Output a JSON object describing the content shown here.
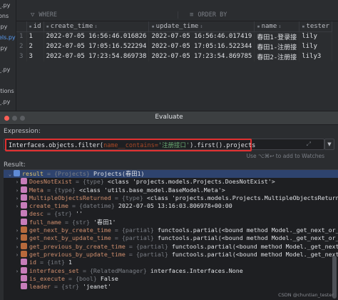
{
  "project_strip": {
    "items": [
      {
        "label": "_.py",
        "color": "normal"
      },
      {
        "label": "ons",
        "color": "normal"
      },
      {
        "label": ".py",
        "color": "normal"
      },
      {
        "label": "els.py",
        "color": "blue"
      },
      {
        "label": ".py",
        "color": "normal"
      },
      {
        "label": "",
        "color": "normal"
      },
      {
        "label": "_.py",
        "color": "normal"
      },
      {
        "label": "",
        "color": "normal"
      },
      {
        "label": "itions",
        "color": "normal"
      },
      {
        "label": "_.py",
        "color": "normal"
      }
    ]
  },
  "grid": {
    "filter_where_label": "WHERE",
    "filter_order_label": "ORDER BY",
    "columns": [
      {
        "label": "id",
        "sort": "↕"
      },
      {
        "label": "create_time",
        "sort": "↕"
      },
      {
        "label": "update_time",
        "sort": "↕"
      },
      {
        "label": "name",
        "sort": "↕"
      },
      {
        "label": "tester",
        "sort": ""
      }
    ],
    "rows": [
      {
        "num": "1",
        "id": "1",
        "create_time": "2022-07-05 16:56:46.016826",
        "update_time": "2022-07-05 16:56:46.017419",
        "name": "春田1-登录接",
        "tester": "lily"
      },
      {
        "num": "2",
        "id": "2",
        "create_time": "2022-07-05 17:05:16.522294",
        "update_time": "2022-07-05 17:05:16.522344",
        "name": "春田1-注册接",
        "tester": "lily"
      },
      {
        "num": "3",
        "id": "3",
        "create_time": "2022-07-05 17:23:54.869738",
        "update_time": "2022-07-05 17:23:54.869785",
        "name": "春田2-注册接",
        "tester": "lily3"
      }
    ]
  },
  "dialog": {
    "title": "Evaluate",
    "expression_label": "Expression:",
    "expression": {
      "part1": "Interfaces.objects.filter(",
      "kwarg": "name__contains=",
      "string": "'注册接口'",
      "part2": ").first().projects"
    },
    "hint": "Use ⌥⌘↩ to add to Watches",
    "result_label": "Result:",
    "tree": [
      {
        "indent": 0,
        "expanded": true,
        "icon": "result",
        "name": "result",
        "type": "= {Projects}",
        "value": "Projects(春田1)",
        "selected": true
      },
      {
        "indent": 1,
        "expanded": false,
        "icon": "field",
        "name": "DoesNotExist",
        "type": "= {type}",
        "value": "<class 'projects.models.Projects.DoesNotExist'>"
      },
      {
        "indent": 1,
        "expanded": false,
        "icon": "field",
        "name": "Meta",
        "type": "= {type}",
        "value": "<class 'utils.base_model.BaseModel.Meta'>"
      },
      {
        "indent": 1,
        "expanded": false,
        "icon": "field",
        "name": "MultipleObjectsReturned",
        "type": "= {type}",
        "value": "<class 'projects.models.Projects.MultipleObjectsReturned'>"
      },
      {
        "indent": 1,
        "expanded": false,
        "icon": "field",
        "name": "create_time",
        "type": "= {datetime}",
        "value": "2022-07-05 13:16:03.806978+00:00"
      },
      {
        "indent": 1,
        "expanded": null,
        "icon": "field",
        "name": "desc",
        "type": "= {str}",
        "value": "''"
      },
      {
        "indent": 1,
        "expanded": null,
        "icon": "field",
        "name": "full_name",
        "type": "= {str}",
        "value": "'春田1'"
      },
      {
        "indent": 1,
        "expanded": false,
        "icon": "method",
        "name": "get_next_by_create_time",
        "type": "= {partial}",
        "value": "functools.partial(<bound method Model._get_next_or_previous_by_FIE"
      },
      {
        "indent": 1,
        "expanded": false,
        "icon": "method",
        "name": "get_next_by_update_time",
        "type": "= {partial}",
        "value": "functools.partial(<bound method Model._get_next_or_previous_by_FIE"
      },
      {
        "indent": 1,
        "expanded": false,
        "icon": "method",
        "name": "get_previous_by_create_time",
        "type": "= {partial}",
        "value": "functools.partial(<bound method Model._get_next_or_previous_by"
      },
      {
        "indent": 1,
        "expanded": false,
        "icon": "method",
        "name": "get_previous_by_update_time",
        "type": "= {partial}",
        "value": "functools.partial(<bound method Model._get_next_or_previous_by"
      },
      {
        "indent": 1,
        "expanded": null,
        "icon": "field",
        "name": "id",
        "type": "= {int}",
        "value": "1"
      },
      {
        "indent": 1,
        "expanded": false,
        "icon": "field",
        "name": "interfaces_set",
        "type": "= {RelatedManager}",
        "value": "interfaces.Interfaces.None"
      },
      {
        "indent": 1,
        "expanded": null,
        "icon": "field",
        "name": "is_execute",
        "type": "= {bool}",
        "value": "False"
      },
      {
        "indent": 1,
        "expanded": null,
        "icon": "field",
        "name": "leader",
        "type": "= {str}",
        "value": "'jeanet'"
      },
      {
        "indent": 1,
        "expanded": null,
        "icon": "field",
        "name": "",
        "type": "",
        "value": ""
      }
    ],
    "watermark": "CSDN @chuntian_tester"
  }
}
